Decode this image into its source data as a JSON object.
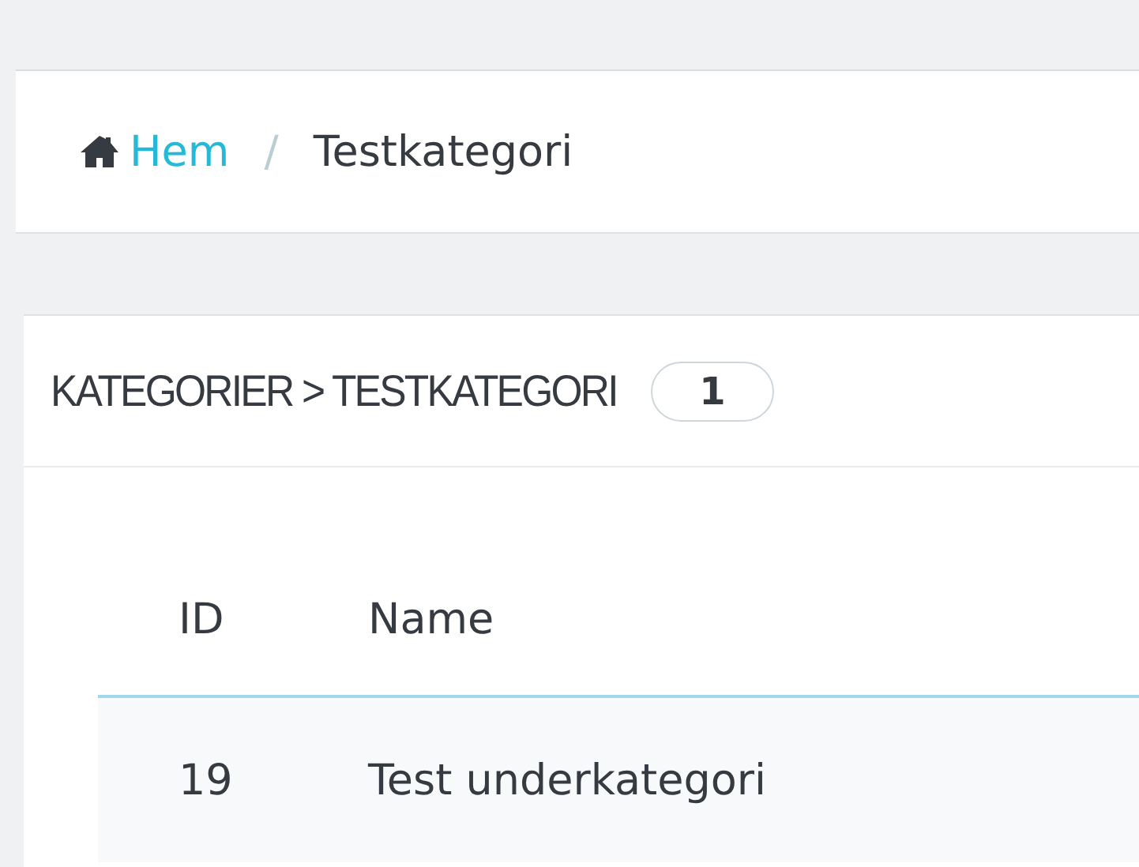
{
  "breadcrumb_separator": "/",
  "breadcrumb": [
    {
      "label": "Hem",
      "kind": "home"
    },
    {
      "label": "Testkategori",
      "kind": "current"
    }
  ],
  "panel": {
    "title": "KATEGORIER > TESTKATEGORI",
    "count": "1"
  },
  "table": {
    "columns": [
      "ID",
      "Name"
    ],
    "rows": [
      {
        "cells": [
          "19",
          "Test underkategori"
        ]
      }
    ]
  }
}
